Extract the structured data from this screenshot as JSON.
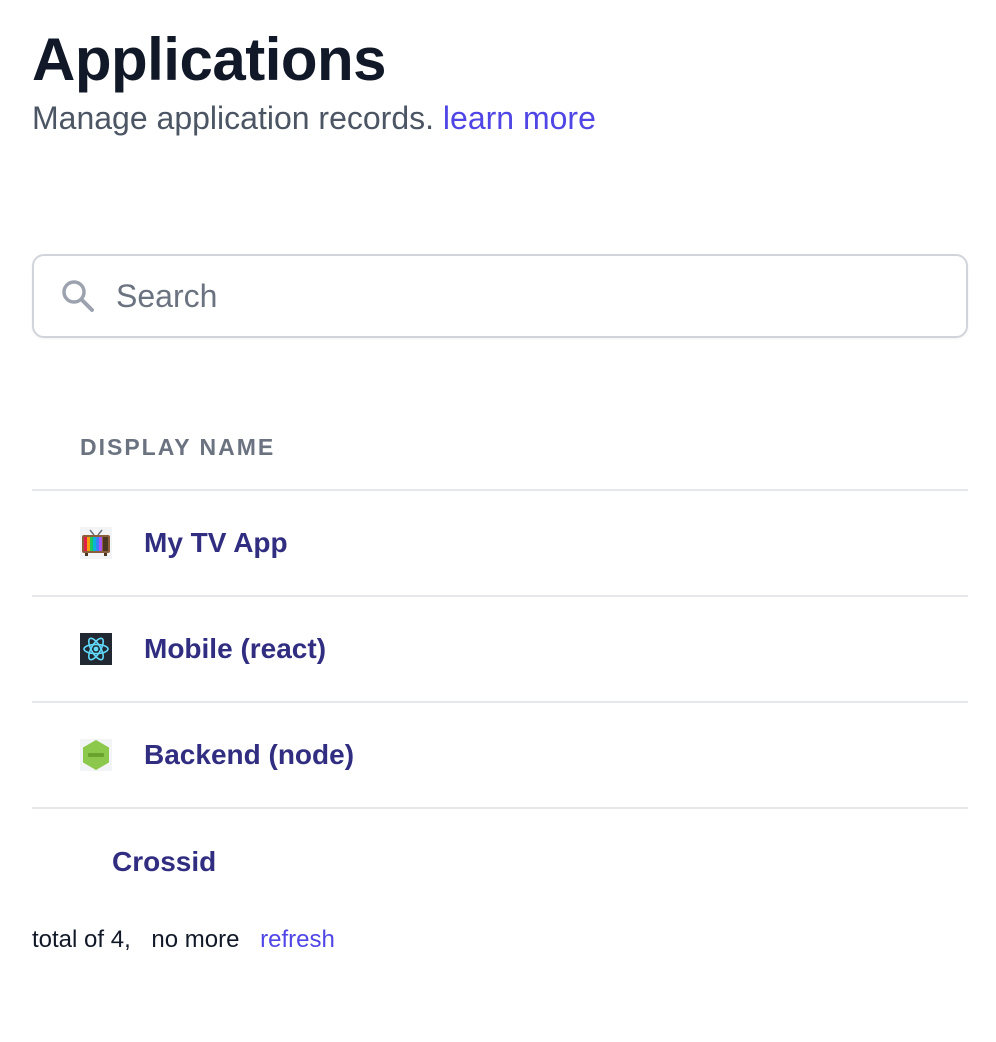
{
  "header": {
    "title": "Applications",
    "subtitle": "Manage application records.",
    "learn_more": "learn more"
  },
  "search": {
    "placeholder": "Search",
    "value": ""
  },
  "table": {
    "columns": [
      "DISPLAY NAME"
    ],
    "rows": [
      {
        "name": "My TV App",
        "icon": "tv-icon"
      },
      {
        "name": "Mobile (react)",
        "icon": "react-icon"
      },
      {
        "name": "Backend (node)",
        "icon": "nodejs-icon"
      },
      {
        "name": "Crossid",
        "icon": ""
      }
    ]
  },
  "footer": {
    "total": "total of 4,",
    "more": "no more",
    "refresh": "refresh"
  },
  "colors": {
    "accent": "#4f46e5",
    "row_link": "#312e81",
    "title": "#111827",
    "muted": "#6b7280",
    "border": "#e5e7eb"
  }
}
